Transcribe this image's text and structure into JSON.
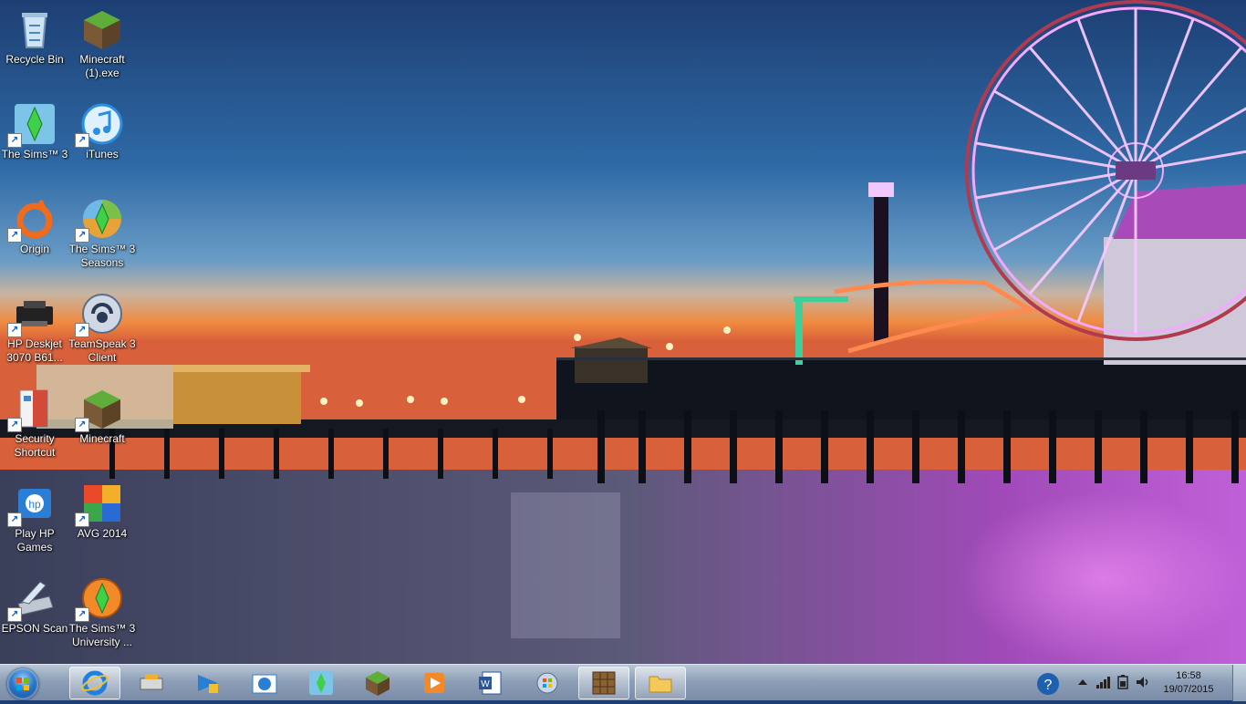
{
  "desktop": {
    "icons": [
      {
        "label": "Recycle Bin",
        "icon": "recycle-bin-icon"
      },
      {
        "label": "Minecraft\n(1).exe",
        "icon": "minecraft-icon"
      },
      {
        "label": "The Sims™ 3",
        "icon": "sims3-icon"
      },
      {
        "label": "iTunes",
        "icon": "itunes-icon"
      },
      {
        "label": "Origin",
        "icon": "origin-icon"
      },
      {
        "label": "The Sims™ 3\nSeasons",
        "icon": "sims3-seasons-icon"
      },
      {
        "label": "HP Deskjet\n3070 B61...",
        "icon": "printer-icon"
      },
      {
        "label": "TeamSpeak 3\nClient",
        "icon": "teamspeak-icon"
      },
      {
        "label": "Security\nShortcut",
        "icon": "security-shortcut-icon"
      },
      {
        "label": "Minecraft",
        "icon": "minecraft-icon"
      },
      {
        "label": "Play HP\nGames",
        "icon": "hp-games-icon"
      },
      {
        "label": "AVG 2014",
        "icon": "avg-icon"
      },
      {
        "label": "EPSON Scan",
        "icon": "scanner-icon"
      },
      {
        "label": "The Sims™ 3\nUniversity ...",
        "icon": "sims3-university-icon"
      }
    ]
  },
  "taskbar": {
    "pinned": [
      {
        "name": "internet-explorer",
        "icon": "internet-explorer-icon",
        "active": true
      },
      {
        "name": "hp-printer-app",
        "icon": "printer-app-icon",
        "active": false
      },
      {
        "name": "teamspeak",
        "icon": "teamspeak-icon",
        "active": false
      },
      {
        "name": "hp",
        "icon": "hp-icon",
        "active": false
      },
      {
        "name": "sims3",
        "icon": "sims3-icon",
        "active": false
      },
      {
        "name": "minecraft",
        "icon": "minecraft-icon",
        "active": false
      },
      {
        "name": "media-player",
        "icon": "media-player-icon",
        "active": false
      },
      {
        "name": "word",
        "icon": "word-icon",
        "active": false
      },
      {
        "name": "windows-update",
        "icon": "windows-update-icon",
        "active": false
      },
      {
        "name": "crafting-table",
        "icon": "crafting-table-icon",
        "active": true
      },
      {
        "name": "file-explorer",
        "icon": "folder-icon",
        "active": true
      }
    ],
    "clock": {
      "time": "16:58",
      "date": "19/07/2015"
    }
  },
  "colors": {
    "sky_top": "#1d3f73",
    "sunset": "#f08a40",
    "neon_pink": "#e46bff",
    "taskbar": "#8ea0b8"
  }
}
